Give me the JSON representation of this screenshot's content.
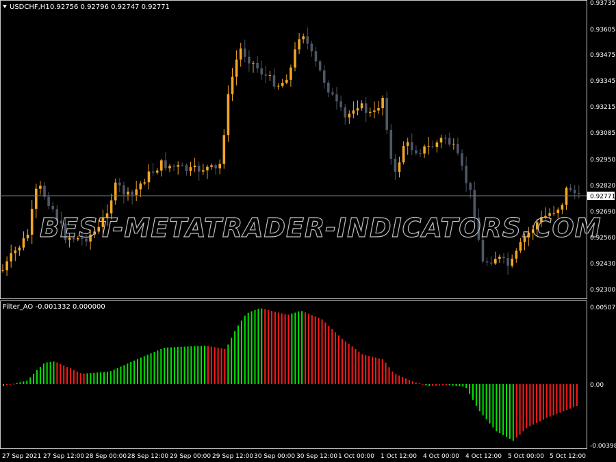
{
  "main_chart": {
    "header_symbol": "USDCHF,H1",
    "header_ohlc": "0.92756 0.92796 0.92747 0.92771",
    "price_labels": [
      "0.93735",
      "0.93605",
      "0.93475",
      "0.93345",
      "0.93215",
      "0.93085",
      "0.92950",
      "0.92820",
      "0.92690",
      "0.92560",
      "0.92430",
      "0.92300"
    ],
    "current_price": "0.92771",
    "bull_color": "#f5a623",
    "bear_color": "#4e5766",
    "price_line_color": "#6f7f8f"
  },
  "indicator": {
    "header": "Filter_AO -0.001332 0.000000",
    "scale_labels": [
      "0.005071",
      "0.00",
      "-0.003986"
    ],
    "up_color": "#00e600",
    "down_color": "#ff1a1a"
  },
  "time_axis": {
    "labels": [
      "27 Sep 2021",
      "27 Sep 12:00",
      "28 Sep 00:00",
      "28 Sep 12:00",
      "29 Sep 00:00",
      "29 Sep 12:00",
      "30 Sep 00:00",
      "30 Sep 12:00",
      "1 Oct 00:00",
      "1 Oct 12:00",
      "4 Oct 00:00",
      "4 Oct 12:00",
      "5 Oct 00:00",
      "5 Oct 12:00"
    ]
  },
  "watermark": "BEST-METATRADER-INDICATORS.COM",
  "icons": {
    "menu": "triangle-down-icon"
  }
}
